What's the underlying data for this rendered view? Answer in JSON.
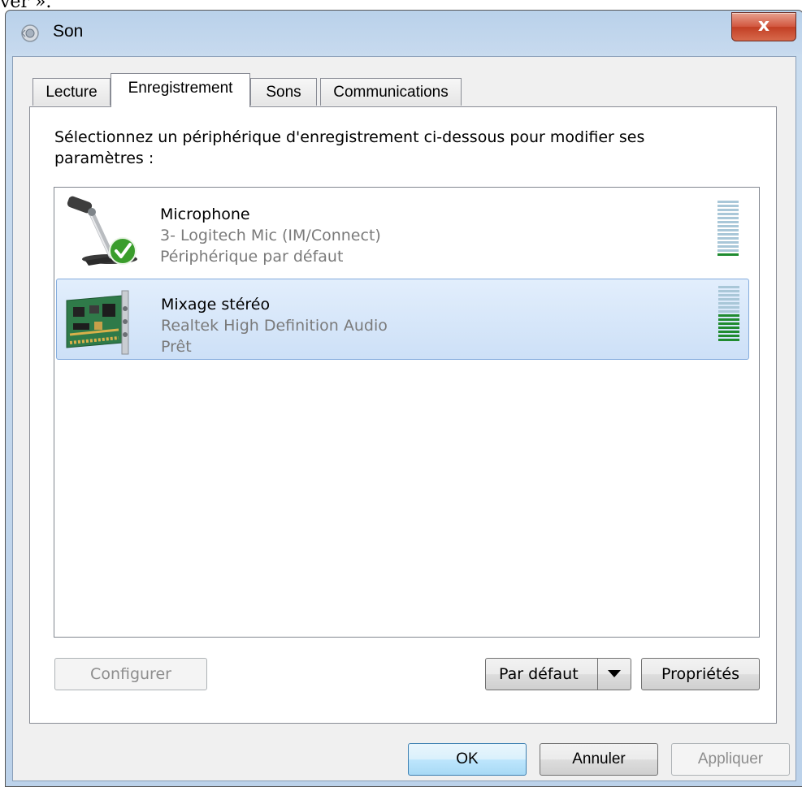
{
  "stray_text": "ver ».",
  "window": {
    "title": "Son",
    "close_label": "x"
  },
  "tabs": [
    {
      "label": "Lecture",
      "active": false
    },
    {
      "label": "Enregistrement",
      "active": true
    },
    {
      "label": "Sons",
      "active": false
    },
    {
      "label": "Communications",
      "active": false
    }
  ],
  "panel": {
    "instruction": "Sélectionnez un périphérique d'enregistrement ci-dessous pour modifier ses paramètres :"
  },
  "devices": [
    {
      "name": "Microphone",
      "description": "3- Logitech Mic (IM/Connect)",
      "status": "Périphérique par défaut",
      "icon": "microphone-default-icon",
      "selected": false,
      "level": 0.08
    },
    {
      "name": "Mixage stéréo",
      "description": "Realtek High Definition Audio",
      "status": "Prêt",
      "icon": "sound-card-icon",
      "selected": true,
      "level": 0.5
    }
  ],
  "buttons": {
    "configure": "Configurer",
    "set_default": "Par défaut",
    "properties": "Propriétés",
    "ok": "OK",
    "cancel": "Annuler",
    "apply": "Appliquer"
  },
  "colors": {
    "meter_on": "#1f8b2f",
    "meter_off": "#a9c7d8",
    "selection": "#cde0f7"
  }
}
